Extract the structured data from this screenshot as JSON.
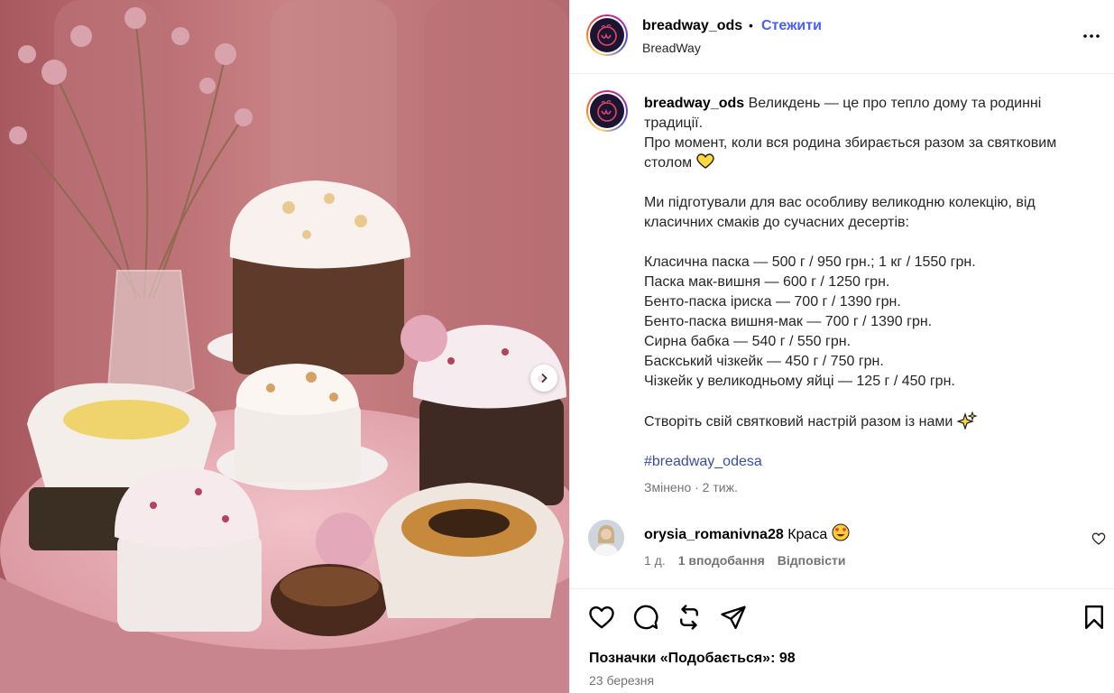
{
  "post": {
    "username": "breadway_ods",
    "follow_label": "Стежити",
    "separator": "•",
    "subtitle": "BreadWay",
    "more_icon": "more-horizontal-icon"
  },
  "caption": {
    "username": "breadway_ods",
    "lines": [
      "Великдень — це про тепло дому та родинні традиції.",
      "Про момент, коли вся родина збирається разом за святковим столом",
      "Ми підготували для вас особливу великодню колекцію, від класичних смаків до сучасних десертів:",
      "Класична паска — 500 г / 950 грн.; 1 кг / 1550 грн.",
      "Паска мак-вишня — 600 г / 1250 грн.",
      "Бенто-паска іриска — 700 г / 1390 грн.",
      "Бенто-паска вишня-мак — 700 г / 1390 грн.",
      "Сирна бабка — 540 г / 550 грн.",
      "Баскський чізкейк — 450 г / 750 грн.",
      "Чізкейк у великодньому яйці — 125 г / 450 грн.",
      "Створіть свій святковий настрій разом із нами"
    ],
    "hashtag": "#breadway_odesa",
    "meta": "Змінено · 2 тиж.",
    "heart_emoji": "yellow-heart-icon",
    "sparkles_emoji": "sparkles-icon"
  },
  "comment": {
    "username": "orysia_romanivna28",
    "text": "Краса",
    "emoji": "heart-eyes-emoji-icon",
    "time": "1 д.",
    "likes": "1 вподобання",
    "reply": "Відповісти"
  },
  "actions": {
    "likes_text": "Позначки «Подобається»: 98",
    "date": "23 березня"
  },
  "colors": {
    "follow": "#4a5df9",
    "hashtag": "#3b4ca8",
    "muted": "#737373",
    "photo_bg": "#c47d80"
  }
}
